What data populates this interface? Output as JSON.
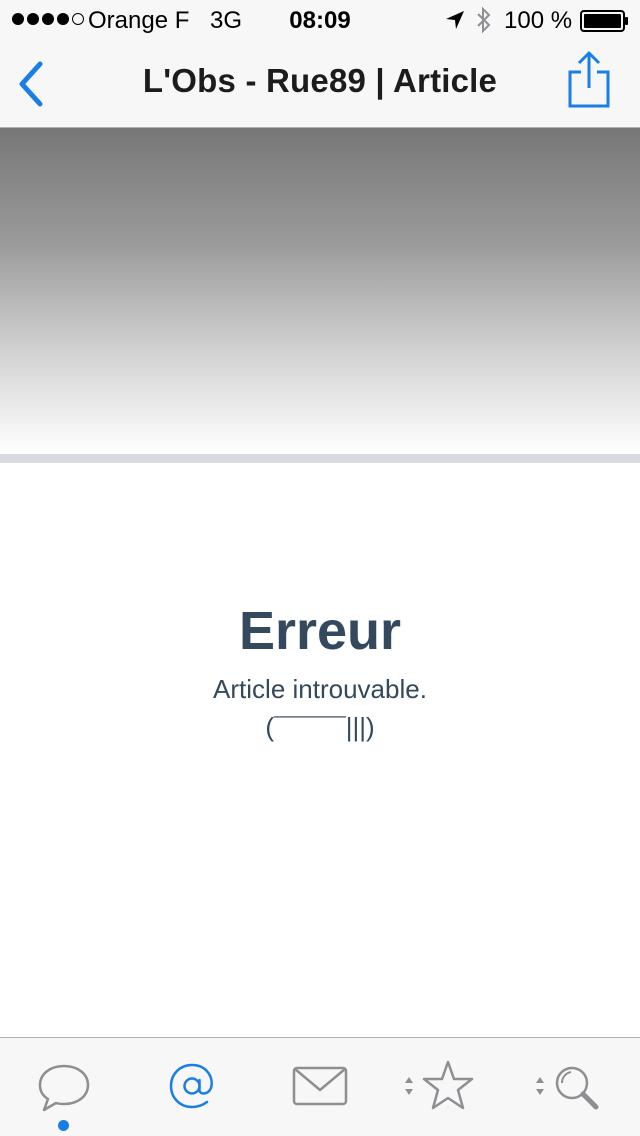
{
  "status_bar": {
    "carrier": "Orange F",
    "network": "3G",
    "time": "08:09",
    "battery": "100 %",
    "icons": [
      "signal-dots",
      "location-arrow-icon",
      "bluetooth-icon",
      "battery-full-icon"
    ]
  },
  "nav": {
    "title": "L'Obs - Rue89 | Article",
    "back_icon": "chevron-left-icon",
    "share_icon": "share-icon"
  },
  "error": {
    "title": "Erreur",
    "message": "Article introuvable. (¯¯¯¯¯|||)"
  },
  "tab_bar": {
    "tabs": [
      {
        "icon": "speech-bubble-icon",
        "active": false,
        "has_indicator": true
      },
      {
        "icon": "at-sign-icon",
        "active": true,
        "has_indicator": false
      },
      {
        "icon": "envelope-icon",
        "active": false,
        "has_indicator": false
      },
      {
        "icon": "star-icon",
        "active": false,
        "has_indicator": false,
        "sortable": true
      },
      {
        "icon": "search-icon",
        "active": false,
        "has_indicator": false,
        "sortable": true
      }
    ]
  },
  "colors": {
    "accent": "#1a7ee6",
    "error_text": "#34495e",
    "bar_background": "#f7f7f7",
    "divider": "#d9d9e1",
    "inactive_icon": "#8e8e93"
  }
}
